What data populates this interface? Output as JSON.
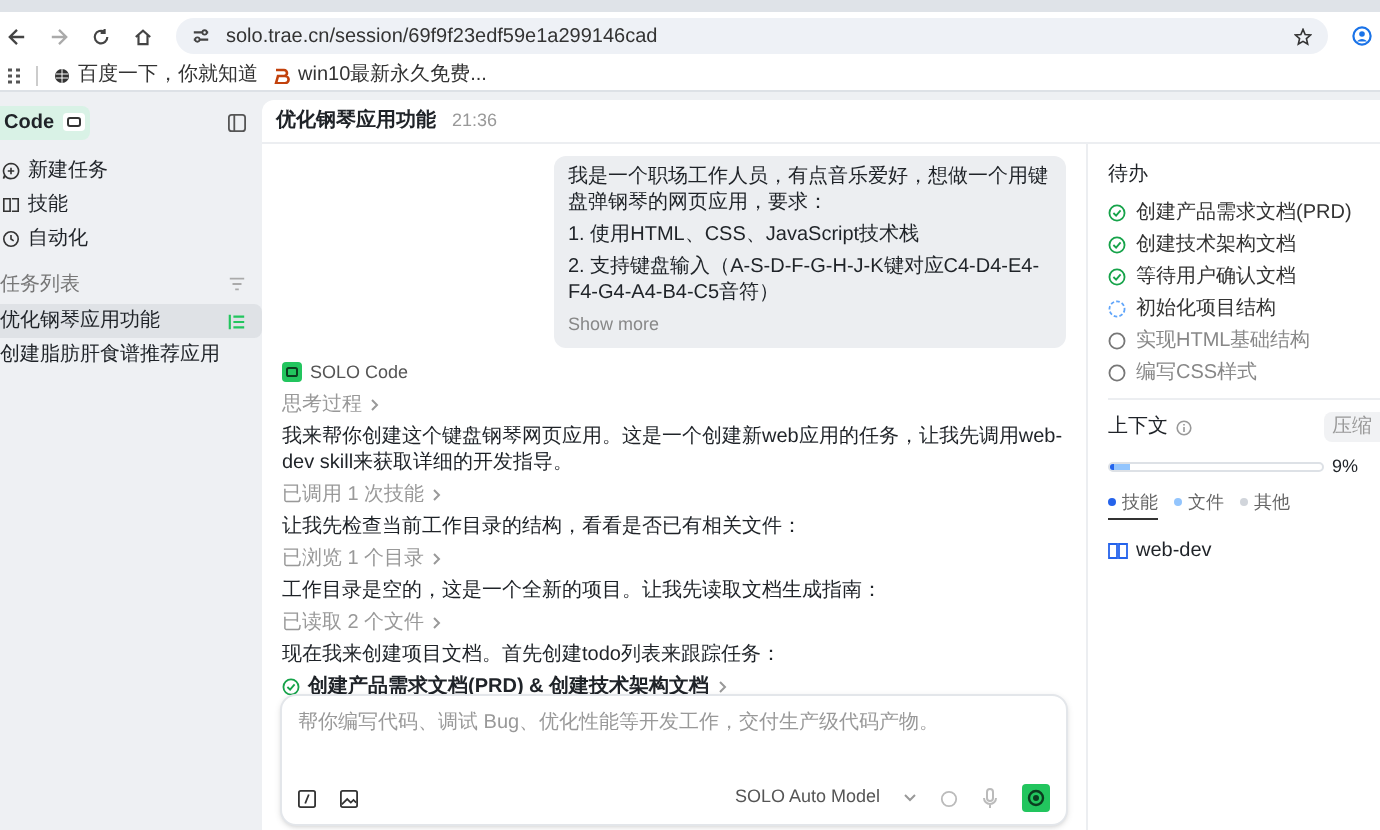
{
  "browser": {
    "url": "solo.trae.cn/session/69f9f23edf59e1a299146cad",
    "bookmarks": [
      {
        "label": "百度一下，你就知道",
        "kind": "globe"
      },
      {
        "label": "win10最新永久免费...",
        "kind": "brand"
      }
    ]
  },
  "sidebar": {
    "brand": "Code",
    "nav": [
      {
        "label": "新建任务",
        "kind": "new"
      },
      {
        "label": "技能",
        "kind": "skills"
      },
      {
        "label": "自动化",
        "kind": "auto"
      }
    ],
    "task_list_title": "任务列表",
    "tasks": [
      {
        "label": "优化钢琴应用功能",
        "selected": true
      },
      {
        "label": "创建脂肪肝食谱推荐应用",
        "selected": false
      }
    ]
  },
  "chat": {
    "title": "优化钢琴应用功能",
    "time": "21:36",
    "user_message": {
      "paragraphs": [
        "我是一个职场工作人员，有点音乐爱好，想做一个用键盘弹钢琴的网页应用，要求：",
        "1. 使用HTML、CSS、JavaScript技术栈",
        "2. 支持键盘输入（A-S-D-F-G-H-J-K键对应C4-D4-E4-F4-G4-A4-B4-C5音符）"
      ],
      "show_more": "Show more"
    },
    "agent": "SOLO Code",
    "steps": [
      {
        "kind": "collapsed",
        "text": "思考过程"
      },
      {
        "kind": "text",
        "text": "我来帮你创建这个键盘钢琴网页应用。这是一个创建新web应用的任务，让我先调用web-dev skill来获取详细的开发指导。"
      },
      {
        "kind": "collapsed",
        "text": "已调用 1 次技能"
      },
      {
        "kind": "text",
        "text": "让我先检查当前工作目录的结构，看看是否已有相关文件："
      },
      {
        "kind": "collapsed",
        "text": "已浏览 1 个目录"
      },
      {
        "kind": "text",
        "text": "工作目录是空的，这是一个全新的项目。让我先读取文档生成指南："
      },
      {
        "kind": "collapsed",
        "text": "已读取 2 个文件"
      },
      {
        "kind": "text",
        "text": "现在我来创建项目文档。首先创建todo列表来跟踪任务："
      },
      {
        "kind": "todo",
        "text": "创建产品需求文档(PRD) & 创建技术架构文档"
      }
    ]
  },
  "input": {
    "placeholder": "帮你编写代码、调试 Bug、优化性能等开发工作，交付生产级代码产物。",
    "model": "SOLO Auto Model"
  },
  "todo": {
    "title": "待办",
    "items": [
      {
        "label": "创建产品需求文档(PRD)",
        "kind": "done"
      },
      {
        "label": "创建技术架构文档",
        "kind": "done"
      },
      {
        "label": "等待用户确认文档",
        "kind": "done"
      },
      {
        "label": "初始化项目结构",
        "kind": "active"
      },
      {
        "label": "实现HTML基础结构",
        "kind": "pending"
      },
      {
        "label": "编写CSS样式",
        "kind": "pending"
      }
    ]
  },
  "context": {
    "title": "上下文",
    "compress_button": "压缩",
    "level": 0.09,
    "reading": "9%",
    "legend": [
      {
        "label": "技能",
        "color": "#2563eb",
        "selected": true
      },
      {
        "label": "文件",
        "color": "#93c5fd",
        "selected": false
      },
      {
        "label": "其他",
        "color": "#d1d5db",
        "selected": false
      }
    ],
    "skills": [
      {
        "label": "web-dev"
      }
    ]
  }
}
